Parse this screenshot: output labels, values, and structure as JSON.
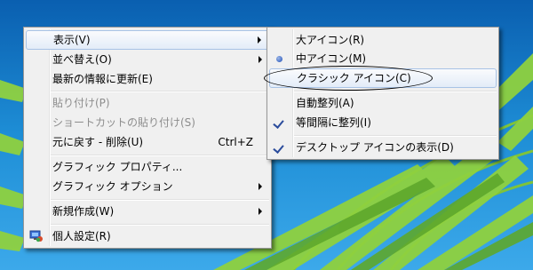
{
  "colors": {
    "menu_bg": "#f0f0f0",
    "highlight_border": "#a8c3e6",
    "disabled_text": "#8d8d8d",
    "bullet": "#1f4fb6"
  },
  "main_menu": {
    "view": "表示(V)",
    "sort": "並べ替え(O)",
    "refresh": "最新の情報に更新(E)",
    "paste": "貼り付け(P)",
    "paste_shortcut": "ショートカットの貼り付け(S)",
    "undo": "元に戻す - 削除(U)",
    "undo_key": "Ctrl+Z",
    "graphics_properties": "グラフィック プロパティ...",
    "graphics_options": "グラフィック オプション",
    "new": "新規作成(W)",
    "personalize": "個人設定(R)"
  },
  "view_submenu": {
    "large_icons": "大アイコン(R)",
    "medium_icons": "中アイコン(M)",
    "classic_icons": "クラシック アイコン(C)",
    "auto_arrange": "自動整列(A)",
    "align_to_grid": "等間隔に整列(I)",
    "show_desktop_icons": "デスクトップ アイコンの表示(D)"
  },
  "state": {
    "selected_icon_size": "medium_icons",
    "align_to_grid_checked": true,
    "show_desktop_icons_checked": true
  }
}
